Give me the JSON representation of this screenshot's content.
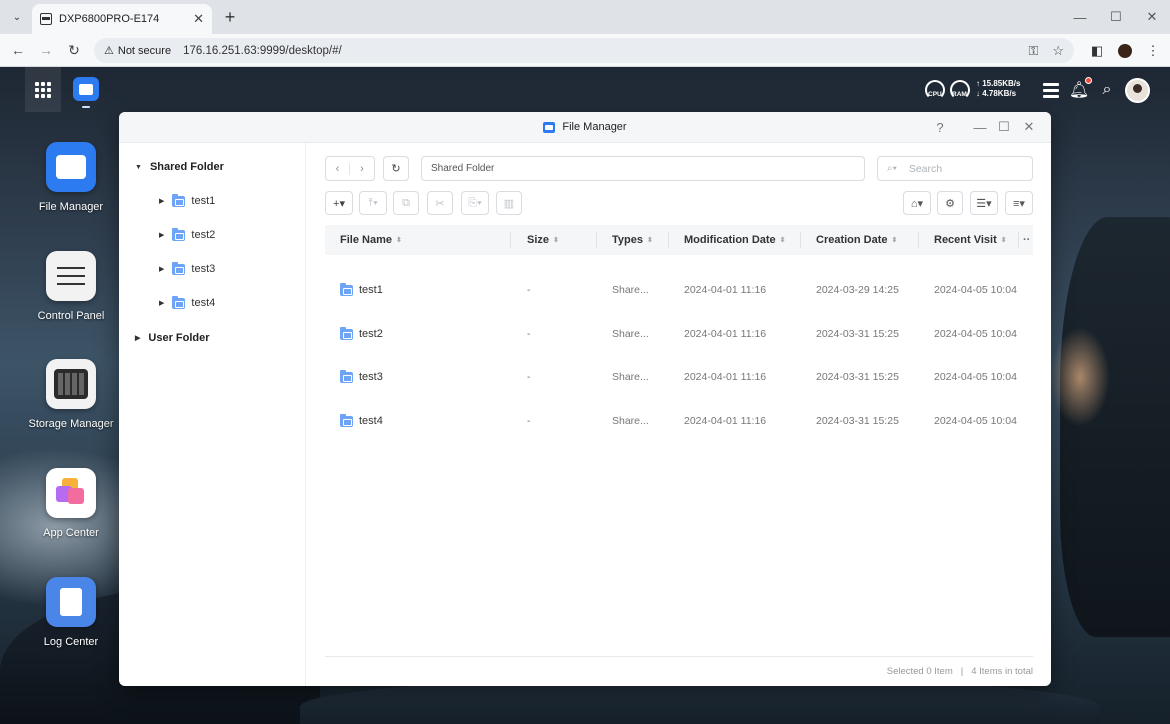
{
  "browser": {
    "tab_title": "DXP6800PRO-E174",
    "tab_close": "✕",
    "new_tab": "+",
    "not_secure": "Not secure",
    "url": "176.16.251.63:9999/desktop/#/"
  },
  "topbar": {
    "cpu_label": "CPU",
    "ram_label": "RAM",
    "upload": "↑ 15.85KB/s",
    "download": "↓ 4.78KB/s"
  },
  "desktop": {
    "icons": [
      {
        "label": "File Manager",
        "color": "#2d7bf1"
      },
      {
        "label": "Control Panel",
        "color": "#f2f2f2"
      },
      {
        "label": "Storage Manager",
        "color": "#f2f2f2"
      },
      {
        "label": "App Center",
        "color": "#ffffff"
      },
      {
        "label": "Log Center",
        "color": "#4a86e8"
      }
    ]
  },
  "window": {
    "title": "File Manager",
    "help": "?"
  },
  "sidebar": {
    "shared_folder": "Shared Folder",
    "children": [
      "test1",
      "test2",
      "test3",
      "test4"
    ],
    "user_folder": "User Folder"
  },
  "toolbar": {
    "path": "Shared Folder",
    "search_placeholder": "Search"
  },
  "table": {
    "columns": [
      "File Name",
      "Size",
      "Types",
      "Modification Date",
      "Creation Date",
      "Recent Visit"
    ],
    "more": "··",
    "rows": [
      {
        "name": "test1",
        "size": "-",
        "type": "Share...",
        "modified": "2024-04-01 11:16",
        "created": "2024-03-29 14:25",
        "visited": "2024-04-05 10:04"
      },
      {
        "name": "test2",
        "size": "-",
        "type": "Share...",
        "modified": "2024-04-01 11:16",
        "created": "2024-03-31 15:25",
        "visited": "2024-04-05 10:04"
      },
      {
        "name": "test3",
        "size": "-",
        "type": "Share...",
        "modified": "2024-04-01 11:16",
        "created": "2024-03-31 15:25",
        "visited": "2024-04-05 10:04"
      },
      {
        "name": "test4",
        "size": "-",
        "type": "Share...",
        "modified": "2024-04-01 11:16",
        "created": "2024-03-31 15:25",
        "visited": "2024-04-05 10:04"
      }
    ]
  },
  "status": {
    "selected": "Selected 0 Item",
    "divider": "|",
    "total": "4 Items in total"
  }
}
